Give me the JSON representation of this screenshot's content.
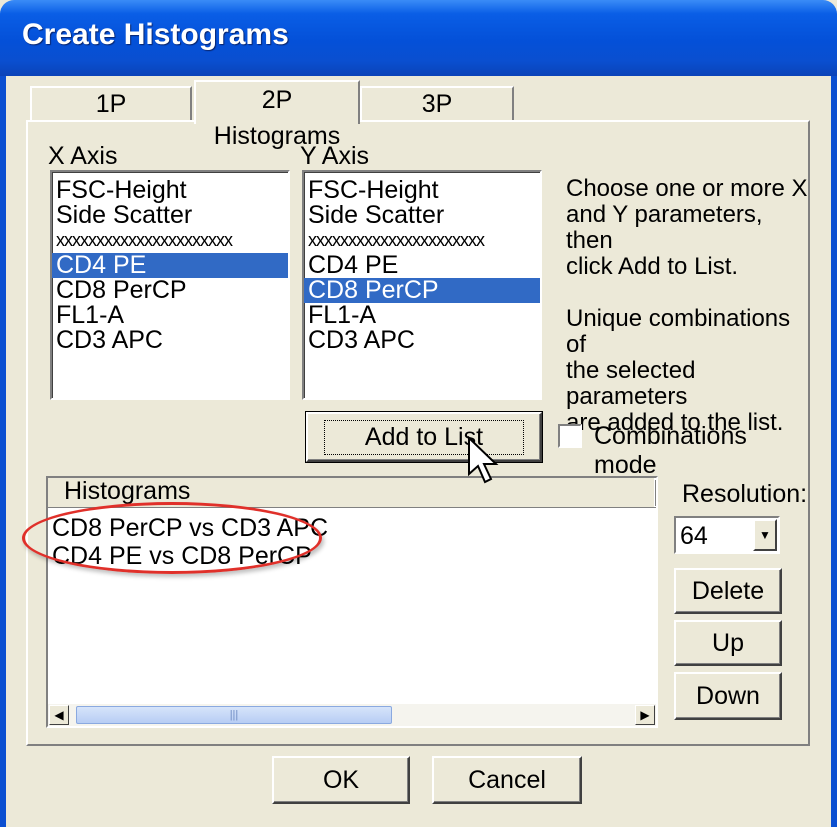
{
  "window": {
    "title": "Create Histograms"
  },
  "tabs": [
    {
      "label": "1P Histograms",
      "active": false
    },
    {
      "label": "2P Histograms",
      "active": true
    },
    {
      "label": "3P Histograms",
      "active": false
    }
  ],
  "x_axis": {
    "label": "X Axis",
    "items": [
      "FSC-Height",
      "Side Scatter",
      "xxxxxxxxxxxxxxxxxxxxxx",
      "CD4 PE",
      "CD8 PerCP",
      "FL1-A",
      "CD3 APC"
    ],
    "selected": "CD4 PE"
  },
  "y_axis": {
    "label": "Y Axis",
    "items": [
      "FSC-Height",
      "Side Scatter",
      "xxxxxxxxxxxxxxxxxxxxxx",
      "CD4 PE",
      "CD8 PerCP",
      "FL1-A",
      "CD3 APC"
    ],
    "selected": "CD8 PerCP"
  },
  "help": {
    "line1": "Choose one or more X",
    "line2": "and Y parameters, then",
    "line3": "click Add to List.",
    "line4": "Unique combinations of",
    "line5": "the selected parameters",
    "line6": "are added to the list."
  },
  "add_button": "Add to List",
  "combinations_mode": {
    "label": "Combinations mode",
    "checked": false
  },
  "histograms": {
    "header": "Histograms",
    "items": [
      "CD8 PerCP vs CD3 APC",
      "CD4 PE vs CD8 PerCP"
    ]
  },
  "resolution": {
    "label": "Resolution:",
    "value": "64"
  },
  "buttons": {
    "delete": "Delete",
    "up": "Up",
    "down": "Down",
    "ok": "OK",
    "cancel": "Cancel"
  },
  "icons": {
    "scroll_left": "left-arrow-icon",
    "scroll_right": "right-arrow-icon",
    "dropdown": "chevron-down-icon",
    "cursor": "mouse-pointer-icon"
  },
  "colors": {
    "selection": "#316ac5",
    "titlebar": "#0a5ee6",
    "annotation": "#e0302a"
  }
}
